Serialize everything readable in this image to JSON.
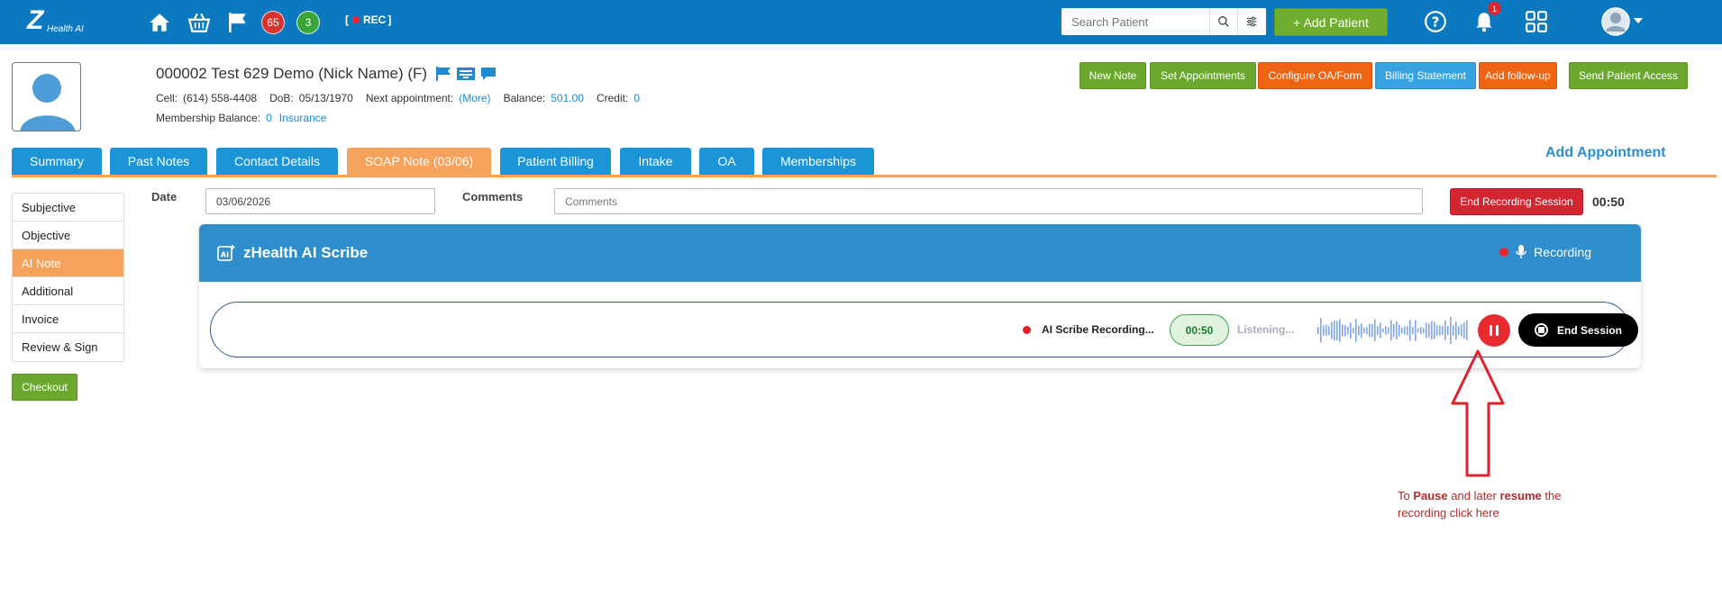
{
  "topbar": {
    "logo_letter": "Z",
    "logo_sub": "Health AI",
    "badge_red": "65",
    "badge_green": "3",
    "rec_label": "REC",
    "search_placeholder": "Search Patient",
    "add_patient": "+ Add Patient",
    "notification_count": "1"
  },
  "patient": {
    "name": "000002 Test 629 Demo  (Nick Name) (F)",
    "cell_label": "Cell:",
    "cell": "(614) 558-4408",
    "dob_label": "DoB:",
    "dob": "05/13/1970",
    "next_appt_label": "Next appointment:",
    "next_appt": "(More)",
    "balance_label": "Balance:",
    "balance": "501.00",
    "credit_label": "Credit:",
    "credit": "0",
    "membership_label": "Membership Balance:",
    "membership": "0",
    "insurance": "Insurance"
  },
  "actions": {
    "new_note": "New Note",
    "set_appointments": "Set Appointments",
    "configure_oa": "Configure OA/Form",
    "billing_statement": "Billing Statement",
    "add_followup": "Add follow-up",
    "send_access": "Send Patient Access"
  },
  "tabs": {
    "summary": "Summary",
    "past_notes": "Past Notes",
    "contact_details": "Contact Details",
    "soap_note": "SOAP Note (03/06)",
    "patient_billing": "Patient Billing",
    "intake": "Intake",
    "oa": "OA",
    "memberships": "Memberships",
    "add_appointment": "Add Appointment"
  },
  "sidenav": {
    "subjective": "Subjective",
    "objective": "Objective",
    "ai_note": "AI Note",
    "additional": "Additional",
    "invoice": "Invoice",
    "review_sign": "Review & Sign",
    "checkout": "Checkout"
  },
  "form": {
    "date_label": "Date",
    "date_value": "03/06/2026",
    "comments_label": "Comments",
    "comments_placeholder": "Comments",
    "end_recording": "End Recording Session",
    "timer": "00:50"
  },
  "scribe": {
    "title": "zHealth AI Scribe",
    "status": "Recording",
    "recording_label": "AI Scribe Recording...",
    "timer": "00:50",
    "listening": "Listening...",
    "end_session": "End Session"
  },
  "annotation": {
    "pre": "To ",
    "pause": "Pause",
    "mid": " and later ",
    "resume": "resume",
    "post": " the recording click here"
  },
  "colors": {
    "topbar": "#0b79c0",
    "tab": "#1c95d7",
    "tab_active": "#f5a25d",
    "annotation": "#b22a2a"
  }
}
